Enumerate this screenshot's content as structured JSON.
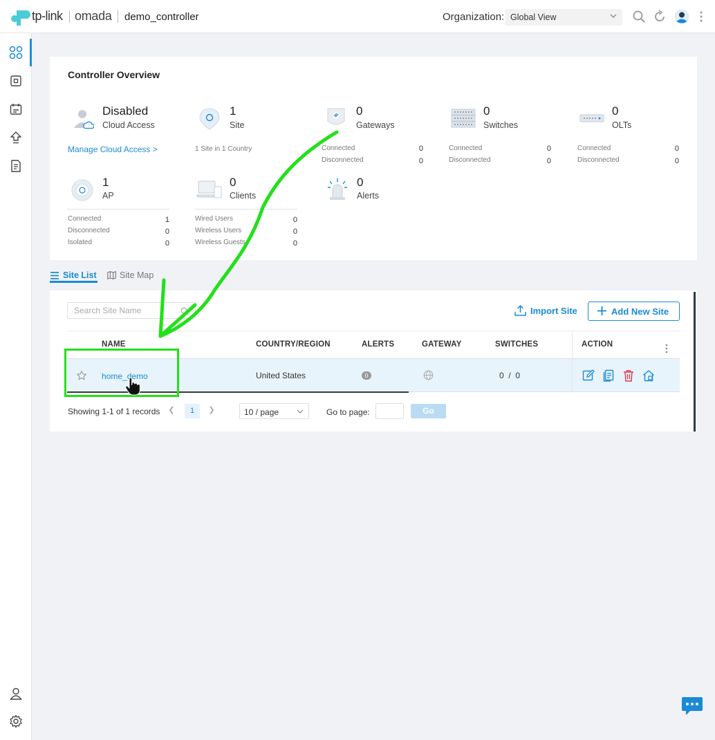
{
  "header": {
    "brand_tp": "tp-link",
    "brand_omada": "omada",
    "controller_name": "demo_controller",
    "org_label": "Organization:",
    "org_value": "Global View",
    "icons": [
      "search-icon",
      "refresh-icon",
      "user-avatar",
      "more-vertical-icon"
    ]
  },
  "sidebar": {
    "items": [
      {
        "name": "dashboard-icon",
        "active": true
      },
      {
        "name": "devices-icon",
        "active": false
      },
      {
        "name": "logs-icon",
        "active": false
      },
      {
        "name": "upgrade-icon",
        "active": false
      },
      {
        "name": "report-icon",
        "active": false
      }
    ],
    "bottom": [
      {
        "name": "account-icon"
      },
      {
        "name": "settings-icon"
      }
    ]
  },
  "overview": {
    "title": "Controller Overview",
    "cloud": {
      "value": "Disabled",
      "label": "Cloud Access",
      "link": "Manage Cloud Access >"
    },
    "site": {
      "value": "1",
      "label": "Site",
      "note": "1 Site in 1 Country"
    },
    "gateways": {
      "value": "0",
      "label": "Gateways",
      "connected_label": "Connected",
      "connected": "0",
      "disconnected_label": "Disconnected",
      "disconnected": "0"
    },
    "switches": {
      "value": "0",
      "label": "Switches",
      "connected_label": "Connected",
      "connected": "0",
      "disconnected_label": "Disconnected",
      "disconnected": "0"
    },
    "olts": {
      "value": "0",
      "label": "OLTs",
      "connected_label": "Connected",
      "connected": "0",
      "disconnected_label": "Disconnected",
      "disconnected": "0"
    },
    "ap": {
      "value": "1",
      "label": "AP",
      "connected_label": "Connected",
      "connected": "1",
      "disconnected_label": "Disconnected",
      "disconnected": "0",
      "isolated_label": "Isolated",
      "isolated": "0"
    },
    "clients": {
      "value": "0",
      "label": "Clients",
      "wired_label": "Wired Users",
      "wired": "0",
      "wireless_label": "Wireless Users",
      "wireless": "0",
      "guests_label": "Wireless Guests",
      "guests": "0"
    },
    "alerts": {
      "value": "0",
      "label": "Alerts"
    }
  },
  "tabs": [
    {
      "label": "Site List",
      "active": true
    },
    {
      "label": "Site Map",
      "active": false
    }
  ],
  "site_list": {
    "search_placeholder": "Search Site Name",
    "import_label": "Import Site",
    "add_label": "Add New Site",
    "columns": [
      "NAME",
      "COUNTRY/REGION",
      "ALERTS",
      "GATEWAY",
      "SWITCHES",
      "ACTION"
    ],
    "rows": [
      {
        "name": "home_demo",
        "country": "United States",
        "alerts": "0",
        "gateway_icon": "globe-icon",
        "switches": "0  /  0"
      }
    ],
    "action_icons": [
      "edit-icon",
      "copy-icon",
      "delete-icon",
      "manage-site-icon"
    ],
    "footer": {
      "showing": "Showing 1-1 of 1 records",
      "current_page": "1",
      "per_page": "10 / page",
      "goto_label": "Go to page:",
      "go_button": "Go"
    }
  },
  "colors": {
    "accent": "#1a8ad6",
    "annotation": "#22e01a",
    "delete": "#e0334a"
  }
}
